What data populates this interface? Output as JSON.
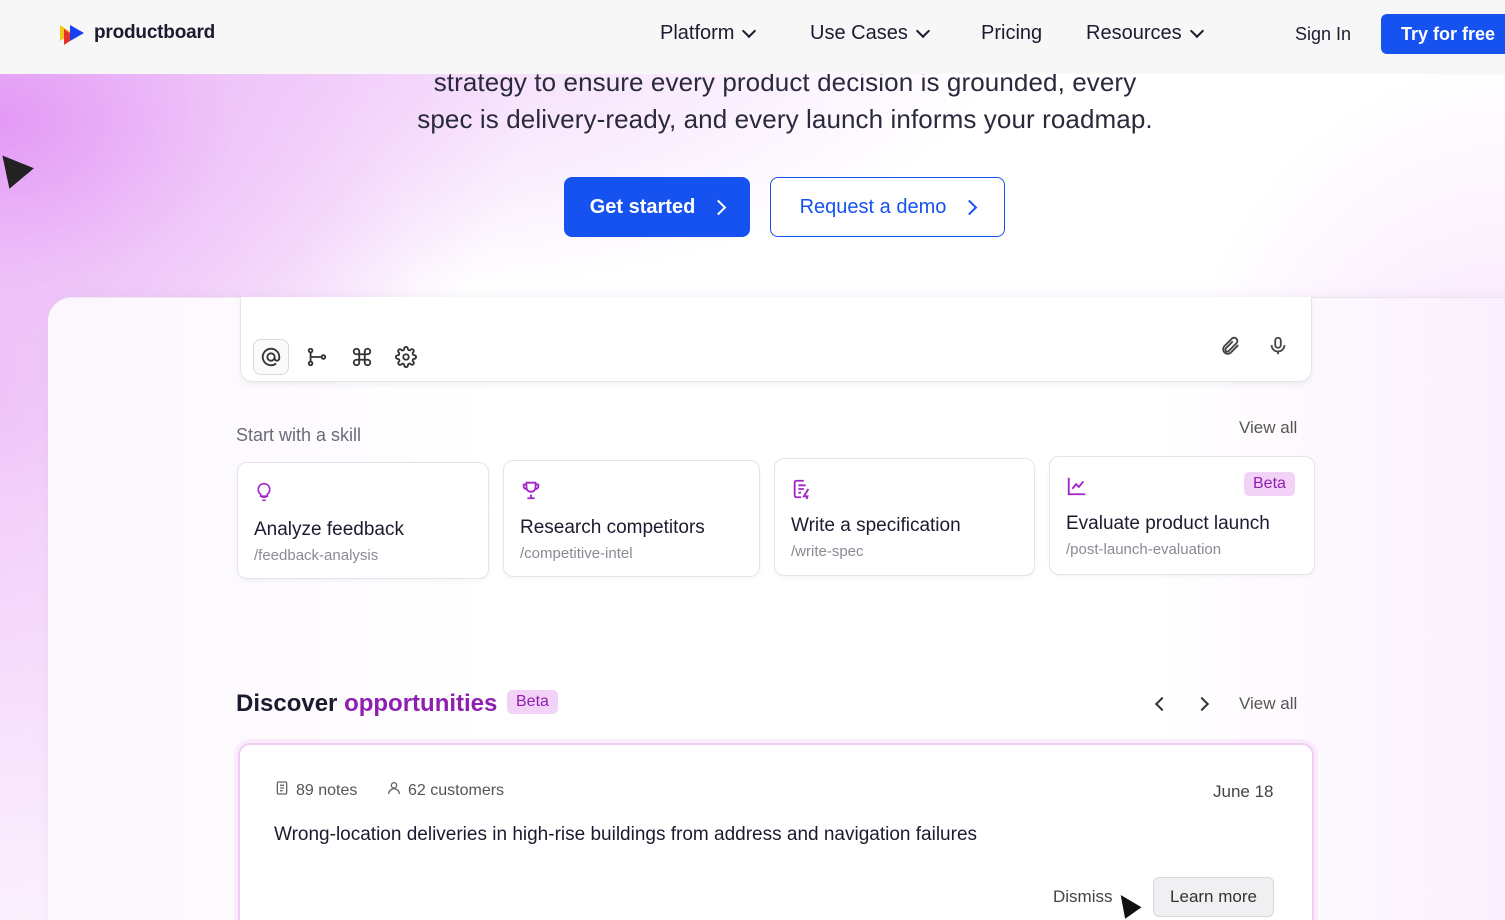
{
  "nav": {
    "brand": "productboard",
    "items": [
      {
        "label": "Platform"
      },
      {
        "label": "Use Cases"
      },
      {
        "label": "Pricing"
      },
      {
        "label": "Resources"
      }
    ],
    "sign_in": "Sign In",
    "cta": "Try for free"
  },
  "hero": {
    "line1": "strategy to ensure every product decision is grounded, every",
    "line2": "spec is delivery-ready, and every launch informs your roadmap.",
    "primary_button": "Get started",
    "secondary_button": "Request a demo"
  },
  "composer": {
    "tools": [
      "at-icon",
      "branch-icon",
      "command-icon",
      "gear-icon"
    ],
    "right_tools": [
      "paperclip-icon",
      "microphone-icon"
    ]
  },
  "skills": {
    "heading": "Start with a skill",
    "view_all": "View all",
    "cards": [
      {
        "title": "Analyze feedback",
        "slug": "/feedback-analysis",
        "icon": "lightbulb-icon"
      },
      {
        "title": "Research competitors",
        "slug": "/competitive-intel",
        "icon": "trophy-icon"
      },
      {
        "title": "Write a specification",
        "slug": "/write-spec",
        "icon": "document-edit-icon"
      },
      {
        "title": "Evaluate product launch",
        "slug": "/post-launch-evaluation",
        "icon": "line-chart-icon",
        "badge": "Beta"
      }
    ]
  },
  "opportunities": {
    "title_part1": "Discover",
    "title_part2": "opportunities",
    "badge": "Beta",
    "view_all": "View all",
    "card": {
      "notes": "89 notes",
      "customers": "62 customers",
      "date": "June 18",
      "text": "Wrong-location deliveries in high-rise buildings from address and navigation failures",
      "dismiss": "Dismiss",
      "learn_more": "Learn more"
    }
  },
  "colors": {
    "primary": "#1652f0",
    "accent": "#8f1fb0",
    "badge_bg": "#f3d2f7"
  }
}
